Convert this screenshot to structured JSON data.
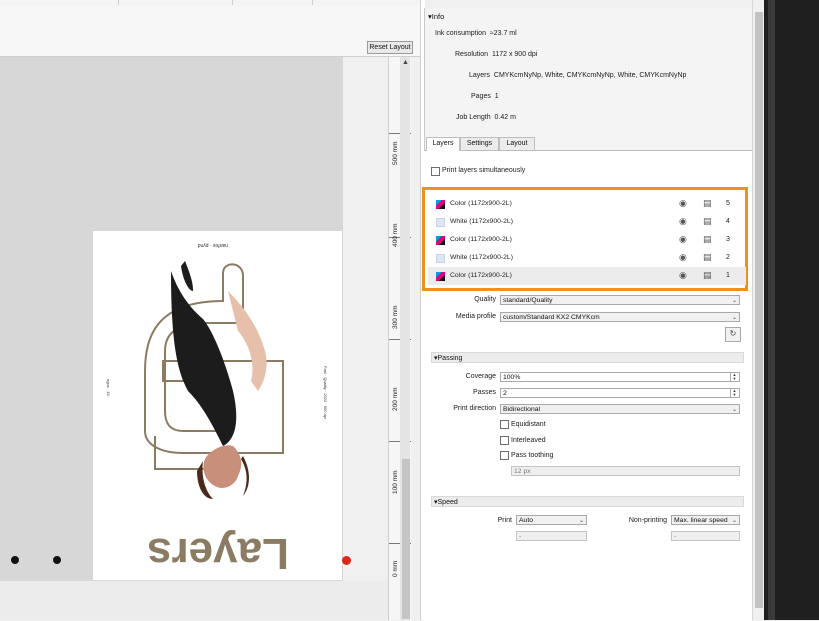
{
  "toolbar": {
    "reset_layout": "Reset Layout"
  },
  "ruler": {
    "labels": [
      "500 mm",
      "400 mm",
      "300 mm",
      "200 mm",
      "100 mm",
      "0 mm"
    ]
  },
  "artwork": {
    "word": "Layers",
    "top_text": "nanfos · pynd",
    "side_text_left": "ngos · 19 ·",
    "side_text_right": "Fast · Quality · 2022 · 900 dpi"
  },
  "info": {
    "header": "Info",
    "rows": [
      {
        "key": "Ink consumption",
        "value": "≈23.7 ml"
      },
      {
        "key": "Resolution",
        "value": "1172 x 900 dpi"
      },
      {
        "key": "Layers",
        "value": "CMYKcmNyNp, White, CMYKcmNyNp, White, CMYKcmNyNp"
      },
      {
        "key": "Pages",
        "value": "1"
      },
      {
        "key": "Job Length",
        "value": "0.42 m"
      }
    ]
  },
  "tabs": [
    {
      "label": "Layers",
      "active": true
    },
    {
      "label": "Settings",
      "active": false
    },
    {
      "label": "Layout",
      "active": false
    }
  ],
  "print_simultaneous": {
    "label": "Print layers simultaneously",
    "checked": false
  },
  "layers": [
    {
      "name": "Color (1172x900-2L)",
      "type": "color",
      "index": "5"
    },
    {
      "name": "White (1172x900-2L)",
      "type": "white",
      "index": "4"
    },
    {
      "name": "Color (1172x900-2L)",
      "type": "color",
      "index": "3"
    },
    {
      "name": "White (1172x900-2L)",
      "type": "white",
      "index": "2"
    },
    {
      "name": "Color (1172x900-2L)",
      "type": "color",
      "index": "1"
    }
  ],
  "quality": {
    "label": "Quality",
    "value": "standard/Quality"
  },
  "media_profile": {
    "label": "Media profile",
    "value": "custom/Standard KX2 CMYKcm"
  },
  "passing": {
    "header": "Passing",
    "coverage_label": "Coverage",
    "coverage_value": "100%",
    "passes_label": "Passes",
    "passes_value": "2",
    "direction_label": "Print direction",
    "direction_value": "Bidirectional",
    "equidistant": "Equidistant",
    "interleaved": "Interleaved",
    "pass_toothing": "Pass toothing",
    "toothing_value": "12 px"
  },
  "speed": {
    "header": "Speed",
    "print_label": "Print",
    "print_value": "Auto",
    "print_sub": "-",
    "nonprint_label": "Non-printing",
    "nonprint_value": "Max. linear speed",
    "nonprint_sub": "-"
  },
  "colors": {
    "highlight": "#f0901e",
    "accent_red": "#e0261c",
    "letter_brown": "#8b7b63"
  }
}
